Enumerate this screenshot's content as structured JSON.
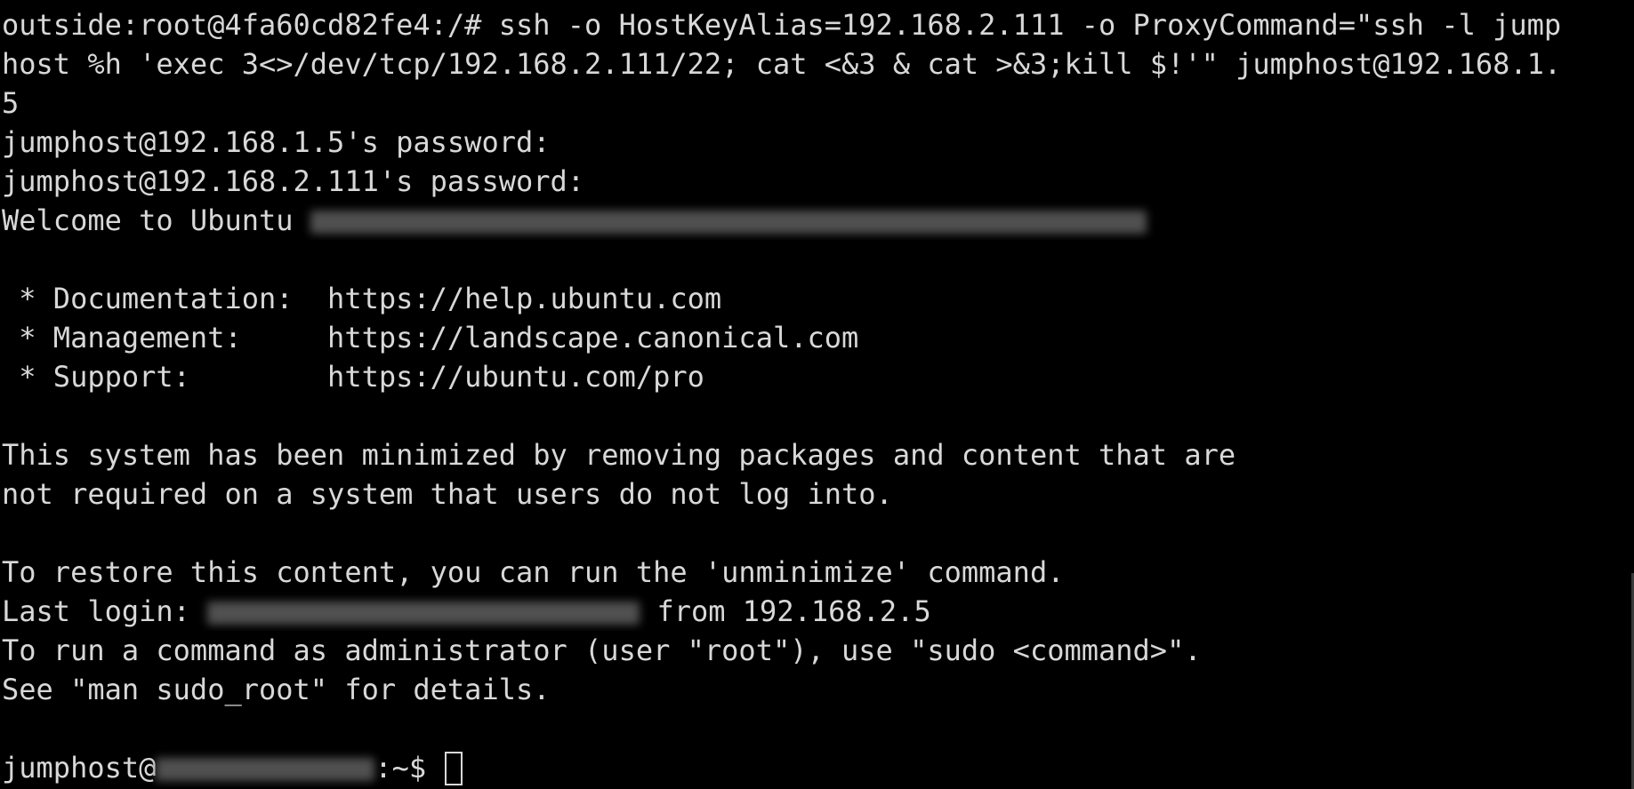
{
  "terminal": {
    "lines": [
      "outside:root@4fa60cd82fe4:/# ssh -o HostKeyAlias=192.168.2.111 -o ProxyCommand=\"ssh -l jump",
      "host %h 'exec 3<>/dev/tcp/192.168.2.111/22; cat <&3 & cat >&3;kill $!'\" jumphost@192.168.1.",
      "5",
      "jumphost@192.168.1.5's password:",
      "jumphost@192.168.2.111's password:",
      "",
      "",
      " * Documentation:  https://help.ubuntu.com",
      " * Management:     https://landscape.canonical.com",
      " * Support:        https://ubuntu.com/pro",
      "",
      "This system has been minimized by removing packages and content that are",
      "not required on a system that users do not log into.",
      "",
      "To restore this content, you can run the 'unminimize' command.",
      "",
      "To run a command as administrator (user \"root\"), use \"sudo <command>\".",
      "See \"man sudo_root\" for details.",
      "",
      ""
    ],
    "welcome": {
      "prefix": "Welcome to Ubuntu "
    },
    "last_login": {
      "prefix": "Last login: ",
      "suffix": " from 192.168.2.5"
    },
    "prompt": {
      "user": "jumphost@",
      "suffix": ":~$ "
    }
  },
  "colors": {
    "background": "#000000",
    "foreground": "#d8d8d8"
  }
}
